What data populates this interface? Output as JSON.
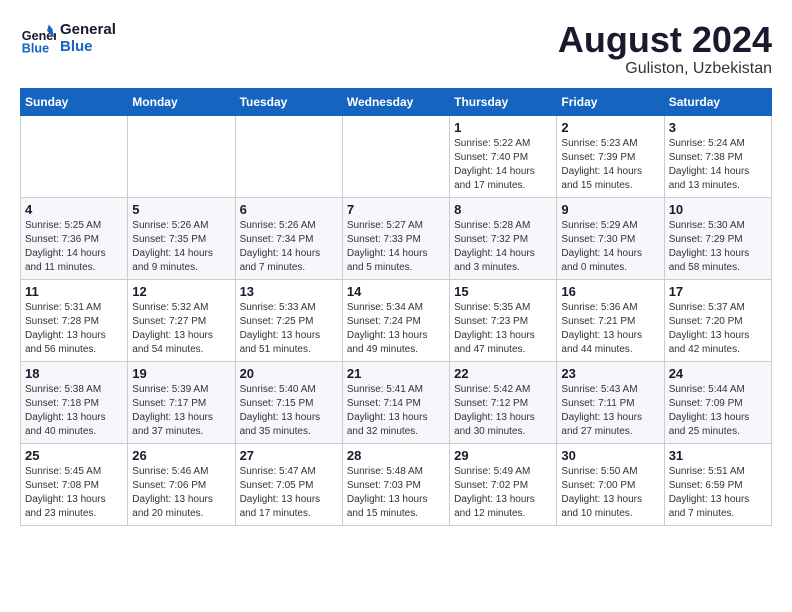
{
  "header": {
    "logo_line1": "General",
    "logo_line2": "Blue",
    "month_year": "August 2024",
    "location": "Guliston, Uzbekistan"
  },
  "days_of_week": [
    "Sunday",
    "Monday",
    "Tuesday",
    "Wednesday",
    "Thursday",
    "Friday",
    "Saturday"
  ],
  "weeks": [
    [
      {
        "day": "",
        "info": ""
      },
      {
        "day": "",
        "info": ""
      },
      {
        "day": "",
        "info": ""
      },
      {
        "day": "",
        "info": ""
      },
      {
        "day": "1",
        "info": "Sunrise: 5:22 AM\nSunset: 7:40 PM\nDaylight: 14 hours\nand 17 minutes."
      },
      {
        "day": "2",
        "info": "Sunrise: 5:23 AM\nSunset: 7:39 PM\nDaylight: 14 hours\nand 15 minutes."
      },
      {
        "day": "3",
        "info": "Sunrise: 5:24 AM\nSunset: 7:38 PM\nDaylight: 14 hours\nand 13 minutes."
      }
    ],
    [
      {
        "day": "4",
        "info": "Sunrise: 5:25 AM\nSunset: 7:36 PM\nDaylight: 14 hours\nand 11 minutes."
      },
      {
        "day": "5",
        "info": "Sunrise: 5:26 AM\nSunset: 7:35 PM\nDaylight: 14 hours\nand 9 minutes."
      },
      {
        "day": "6",
        "info": "Sunrise: 5:26 AM\nSunset: 7:34 PM\nDaylight: 14 hours\nand 7 minutes."
      },
      {
        "day": "7",
        "info": "Sunrise: 5:27 AM\nSunset: 7:33 PM\nDaylight: 14 hours\nand 5 minutes."
      },
      {
        "day": "8",
        "info": "Sunrise: 5:28 AM\nSunset: 7:32 PM\nDaylight: 14 hours\nand 3 minutes."
      },
      {
        "day": "9",
        "info": "Sunrise: 5:29 AM\nSunset: 7:30 PM\nDaylight: 14 hours\nand 0 minutes."
      },
      {
        "day": "10",
        "info": "Sunrise: 5:30 AM\nSunset: 7:29 PM\nDaylight: 13 hours\nand 58 minutes."
      }
    ],
    [
      {
        "day": "11",
        "info": "Sunrise: 5:31 AM\nSunset: 7:28 PM\nDaylight: 13 hours\nand 56 minutes."
      },
      {
        "day": "12",
        "info": "Sunrise: 5:32 AM\nSunset: 7:27 PM\nDaylight: 13 hours\nand 54 minutes."
      },
      {
        "day": "13",
        "info": "Sunrise: 5:33 AM\nSunset: 7:25 PM\nDaylight: 13 hours\nand 51 minutes."
      },
      {
        "day": "14",
        "info": "Sunrise: 5:34 AM\nSunset: 7:24 PM\nDaylight: 13 hours\nand 49 minutes."
      },
      {
        "day": "15",
        "info": "Sunrise: 5:35 AM\nSunset: 7:23 PM\nDaylight: 13 hours\nand 47 minutes."
      },
      {
        "day": "16",
        "info": "Sunrise: 5:36 AM\nSunset: 7:21 PM\nDaylight: 13 hours\nand 44 minutes."
      },
      {
        "day": "17",
        "info": "Sunrise: 5:37 AM\nSunset: 7:20 PM\nDaylight: 13 hours\nand 42 minutes."
      }
    ],
    [
      {
        "day": "18",
        "info": "Sunrise: 5:38 AM\nSunset: 7:18 PM\nDaylight: 13 hours\nand 40 minutes."
      },
      {
        "day": "19",
        "info": "Sunrise: 5:39 AM\nSunset: 7:17 PM\nDaylight: 13 hours\nand 37 minutes."
      },
      {
        "day": "20",
        "info": "Sunrise: 5:40 AM\nSunset: 7:15 PM\nDaylight: 13 hours\nand 35 minutes."
      },
      {
        "day": "21",
        "info": "Sunrise: 5:41 AM\nSunset: 7:14 PM\nDaylight: 13 hours\nand 32 minutes."
      },
      {
        "day": "22",
        "info": "Sunrise: 5:42 AM\nSunset: 7:12 PM\nDaylight: 13 hours\nand 30 minutes."
      },
      {
        "day": "23",
        "info": "Sunrise: 5:43 AM\nSunset: 7:11 PM\nDaylight: 13 hours\nand 27 minutes."
      },
      {
        "day": "24",
        "info": "Sunrise: 5:44 AM\nSunset: 7:09 PM\nDaylight: 13 hours\nand 25 minutes."
      }
    ],
    [
      {
        "day": "25",
        "info": "Sunrise: 5:45 AM\nSunset: 7:08 PM\nDaylight: 13 hours\nand 23 minutes."
      },
      {
        "day": "26",
        "info": "Sunrise: 5:46 AM\nSunset: 7:06 PM\nDaylight: 13 hours\nand 20 minutes."
      },
      {
        "day": "27",
        "info": "Sunrise: 5:47 AM\nSunset: 7:05 PM\nDaylight: 13 hours\nand 17 minutes."
      },
      {
        "day": "28",
        "info": "Sunrise: 5:48 AM\nSunset: 7:03 PM\nDaylight: 13 hours\nand 15 minutes."
      },
      {
        "day": "29",
        "info": "Sunrise: 5:49 AM\nSunset: 7:02 PM\nDaylight: 13 hours\nand 12 minutes."
      },
      {
        "day": "30",
        "info": "Sunrise: 5:50 AM\nSunset: 7:00 PM\nDaylight: 13 hours\nand 10 minutes."
      },
      {
        "day": "31",
        "info": "Sunrise: 5:51 AM\nSunset: 6:59 PM\nDaylight: 13 hours\nand 7 minutes."
      }
    ]
  ]
}
